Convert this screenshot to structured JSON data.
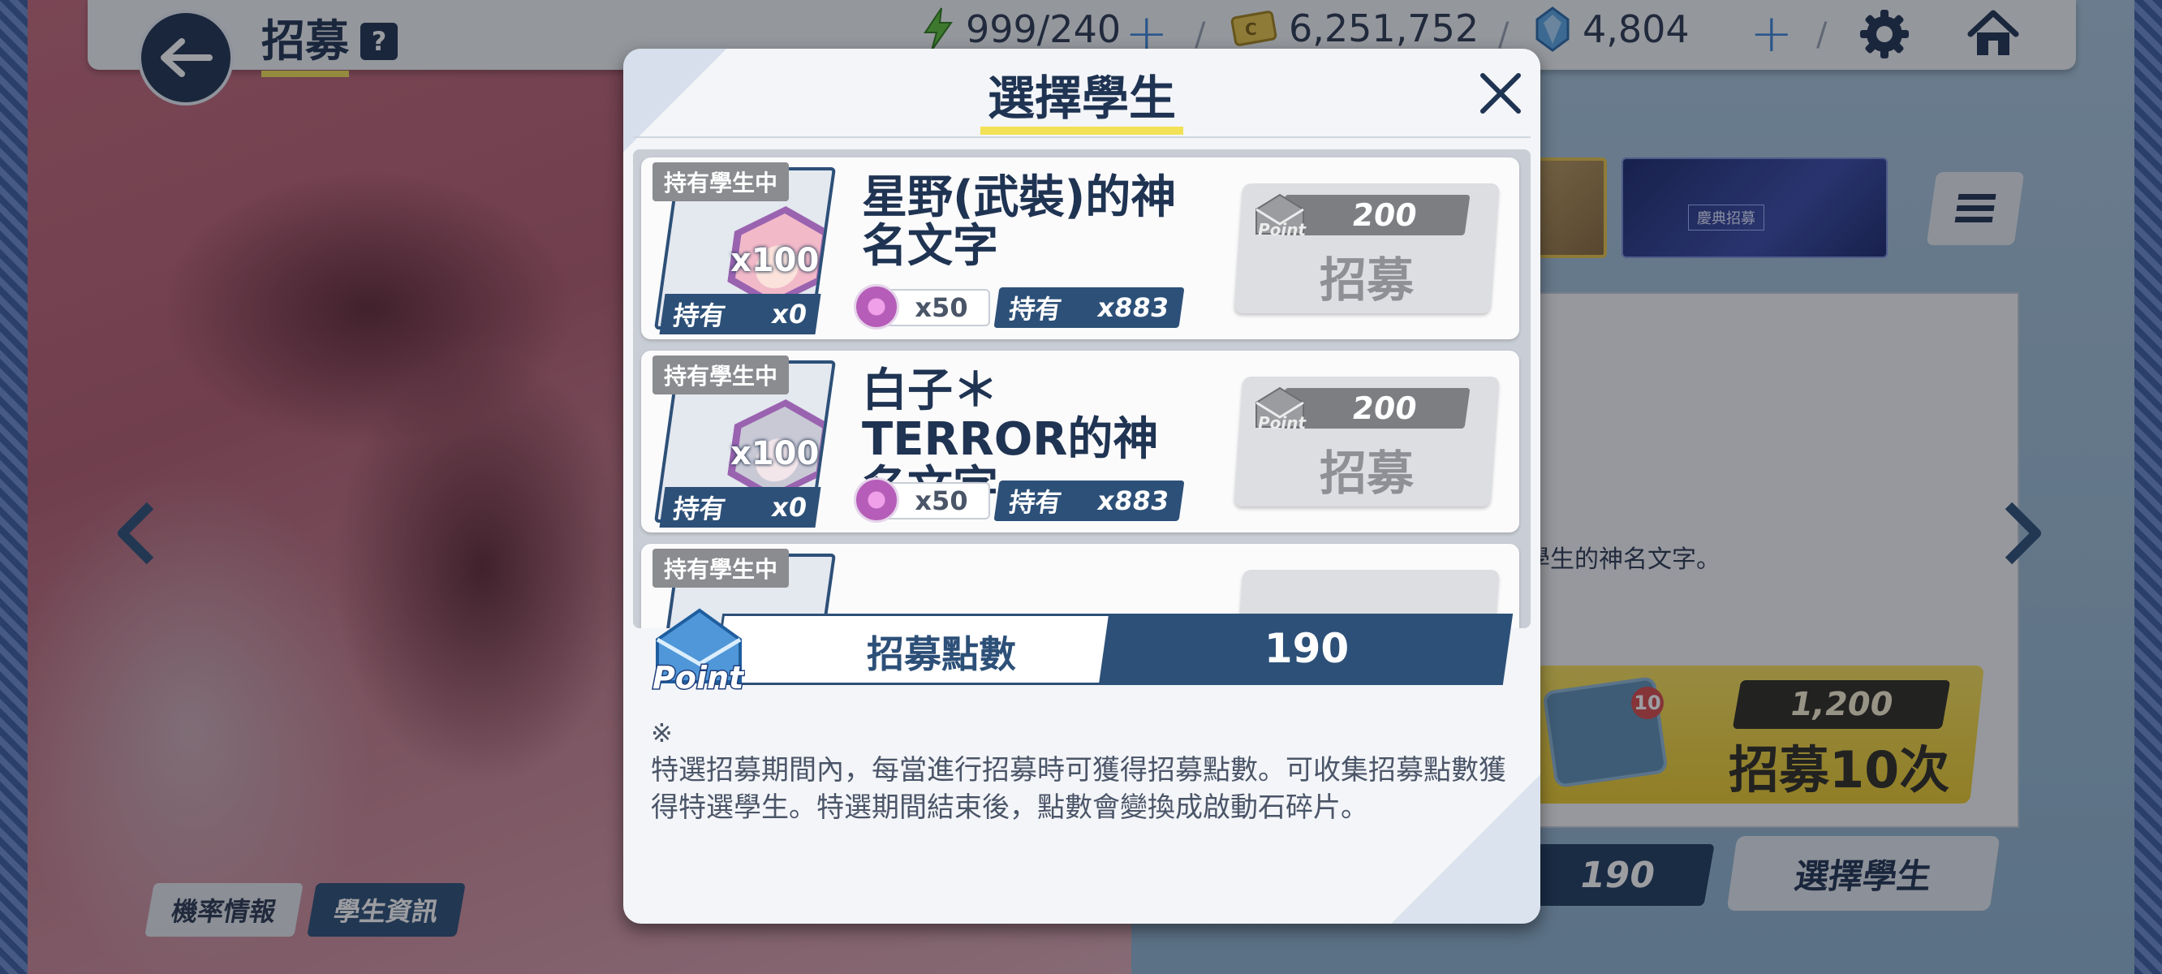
{
  "header": {
    "title": "招募",
    "help_label": "?",
    "energy": "999/240",
    "credits": "6,251,752",
    "gems": "4,804"
  },
  "background_page": {
    "info_text": "學生的神名文字。",
    "recruit10_cost": "1,200",
    "recruit10_label": "招募10次",
    "recruit10_badge": "10",
    "banner_text": "慶典招募",
    "points_value": "190",
    "select_button_label": "選擇學生",
    "tabs": [
      {
        "label": "機率情報",
        "active": false
      },
      {
        "label": "學生資訊",
        "active": true
      }
    ]
  },
  "modal": {
    "title": "選擇學生",
    "students": [
      {
        "tag": "持有學生中",
        "quantity": "x100",
        "owned_label": "持有",
        "owned_count": "x0",
        "name": "星野(武裝)的神名文字",
        "eleph_cost": "x50",
        "eleph_owned_label": "持有",
        "eleph_owned": "x883",
        "point_cost": "200",
        "button_label": "招募",
        "hair_color": "#f2b9c9"
      },
      {
        "tag": "持有學生中",
        "quantity": "x100",
        "owned_label": "持有",
        "owned_count": "x0",
        "name": "白子＊TERROR的神名文字",
        "eleph_cost": "x50",
        "eleph_owned_label": "持有",
        "eleph_owned": "x883",
        "point_cost": "200",
        "button_label": "招募",
        "hair_color": "#c9c9d6"
      },
      {
        "tag": "持有學生中"
      }
    ],
    "point_icon_text": "Point",
    "points_label": "招募點數",
    "points_value": "190",
    "note_mark": "※",
    "note_text": "特選招募期間內，每當進行招募時可獲得招募點數。可收集招募點數獲得特選學生。特選期間結束後，點數會變換成啟動石碎片。"
  },
  "colors": {
    "navy": "#1f3352",
    "card_blue": "#2d5078",
    "accent_yellow": "#f2e155",
    "disabled_gray": "#dcdee1"
  }
}
